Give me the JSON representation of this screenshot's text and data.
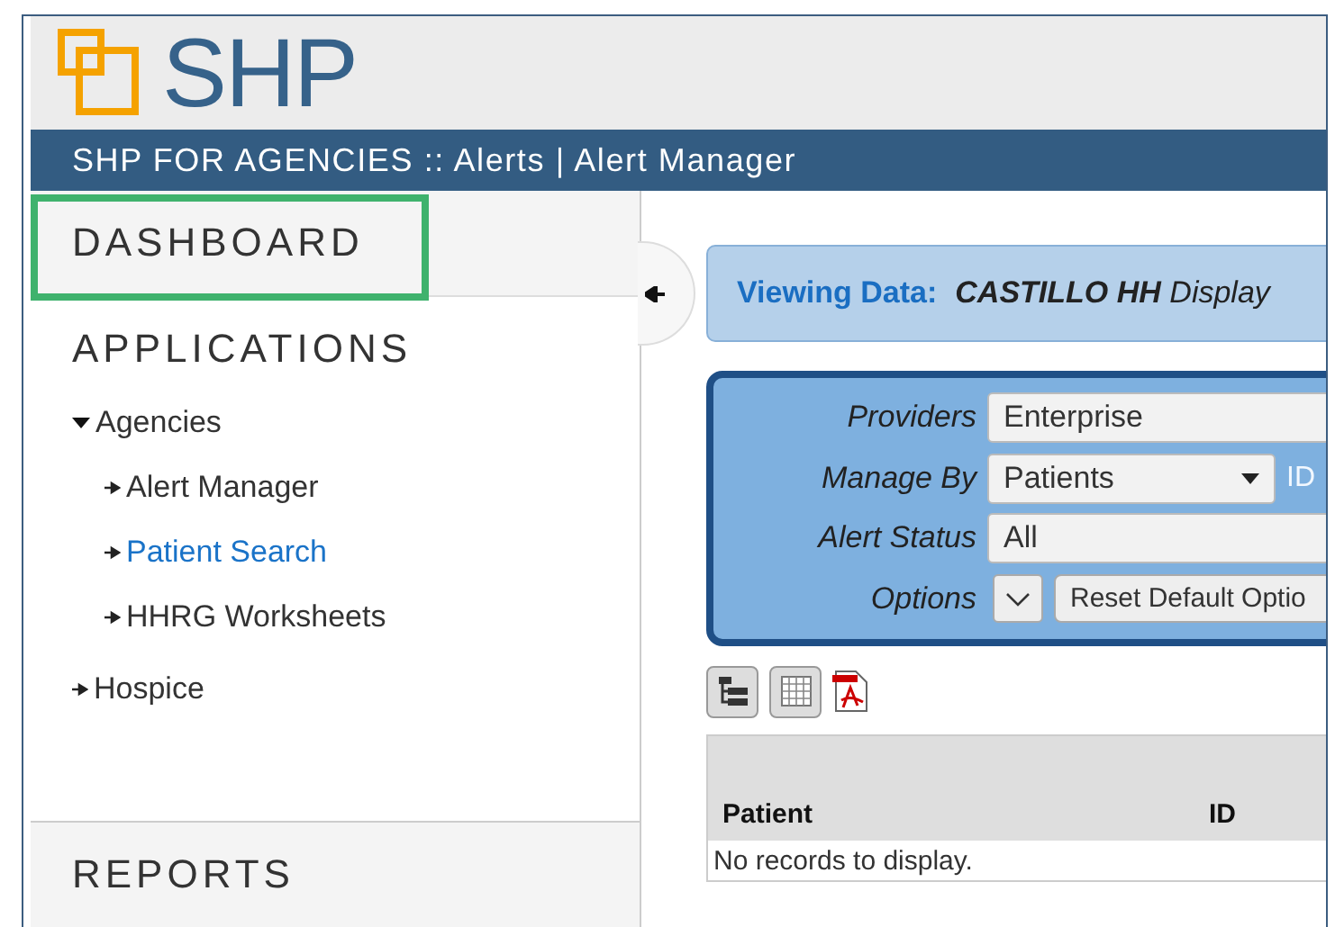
{
  "header": {
    "logo_text": "SHP",
    "breadcrumb": "SHP FOR AGENCIES :: Alerts | Alert Manager"
  },
  "sidebar": {
    "dashboard": {
      "label": "DASHBOARD",
      "highlighted": true
    },
    "applications": "APPLICATIONS",
    "tree": [
      {
        "label": "Agencies",
        "expanded": true,
        "selected": false,
        "children": [
          {
            "label": "Alert Manager",
            "selected": false
          },
          {
            "label": "Patient Search",
            "selected": true
          },
          {
            "label": "HHRG Worksheets",
            "selected": false
          }
        ]
      },
      {
        "label": "Hospice",
        "expanded": false,
        "selected": false
      }
    ],
    "reports": "REPORTS"
  },
  "viewing": {
    "label": "Viewing Data:",
    "value": "**CASTILLO HH** Display"
  },
  "filters": [
    {
      "kind": "field",
      "label": "Providers",
      "value": "Enterprise"
    },
    {
      "kind": "select",
      "label": "Manage By",
      "value": "Patients",
      "extra": "ID"
    },
    {
      "kind": "field",
      "label": "Alert Status",
      "value": "All"
    },
    {
      "kind": "options",
      "label": "Options",
      "button": "Reset Default Optio"
    }
  ],
  "table": {
    "columns": [
      "Patient",
      "ID"
    ],
    "empty_message": "No records to display."
  }
}
